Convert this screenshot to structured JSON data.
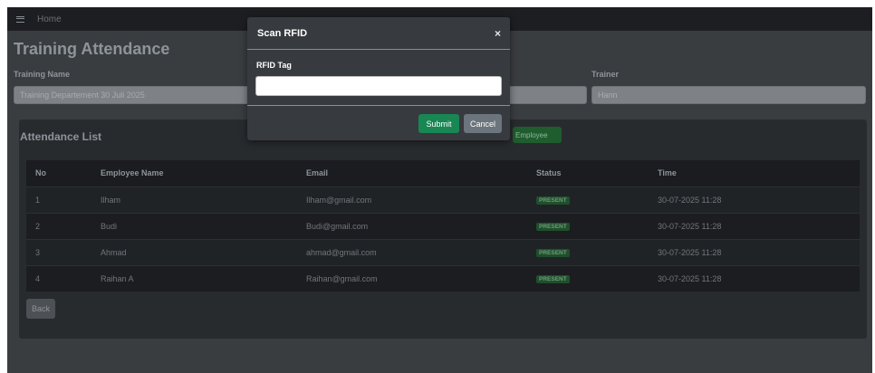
{
  "topbar": {
    "menu_icon": "hamburger-icon",
    "home_label": "Home"
  },
  "page": {
    "title": "Training Attendance",
    "training_name_label": "Training Name",
    "training_name_value": "Training  Departement 30 Juli 2025",
    "trainer_label": "Trainer",
    "trainer_value": "Hann"
  },
  "attendance": {
    "title": "Attendance List",
    "add_button_label": "Employee",
    "columns": [
      "No",
      "Employee Name",
      "Email",
      "Status",
      "Time"
    ],
    "rows": [
      {
        "no": "1",
        "name": "Ilham",
        "email": "Ilham@gmail.com",
        "status": "PRESENT",
        "time": "30-07-2025 11:28"
      },
      {
        "no": "2",
        "name": "Budi",
        "email": "Budi@gmail.com",
        "status": "PRESENT",
        "time": "30-07-2025 11:28"
      },
      {
        "no": "3",
        "name": "Ahmad",
        "email": "ahmad@gmail.com",
        "status": "PRESENT",
        "time": "30-07-2025 11:28"
      },
      {
        "no": "4",
        "name": "Raihan A",
        "email": "Raihan@gmail.com",
        "status": "PRESENT",
        "time": "30-07-2025 11:28"
      }
    ],
    "back_label": "Back"
  },
  "modal": {
    "title": "Scan RFID",
    "close_glyph": "×",
    "field_label": "RFID Tag",
    "field_value": "",
    "submit_label": "Submit",
    "cancel_label": "Cancel"
  },
  "colors": {
    "submit": "#198754",
    "cancel": "#6c757d",
    "status_present": "#1f4f2b",
    "background": "#3a3d40"
  }
}
